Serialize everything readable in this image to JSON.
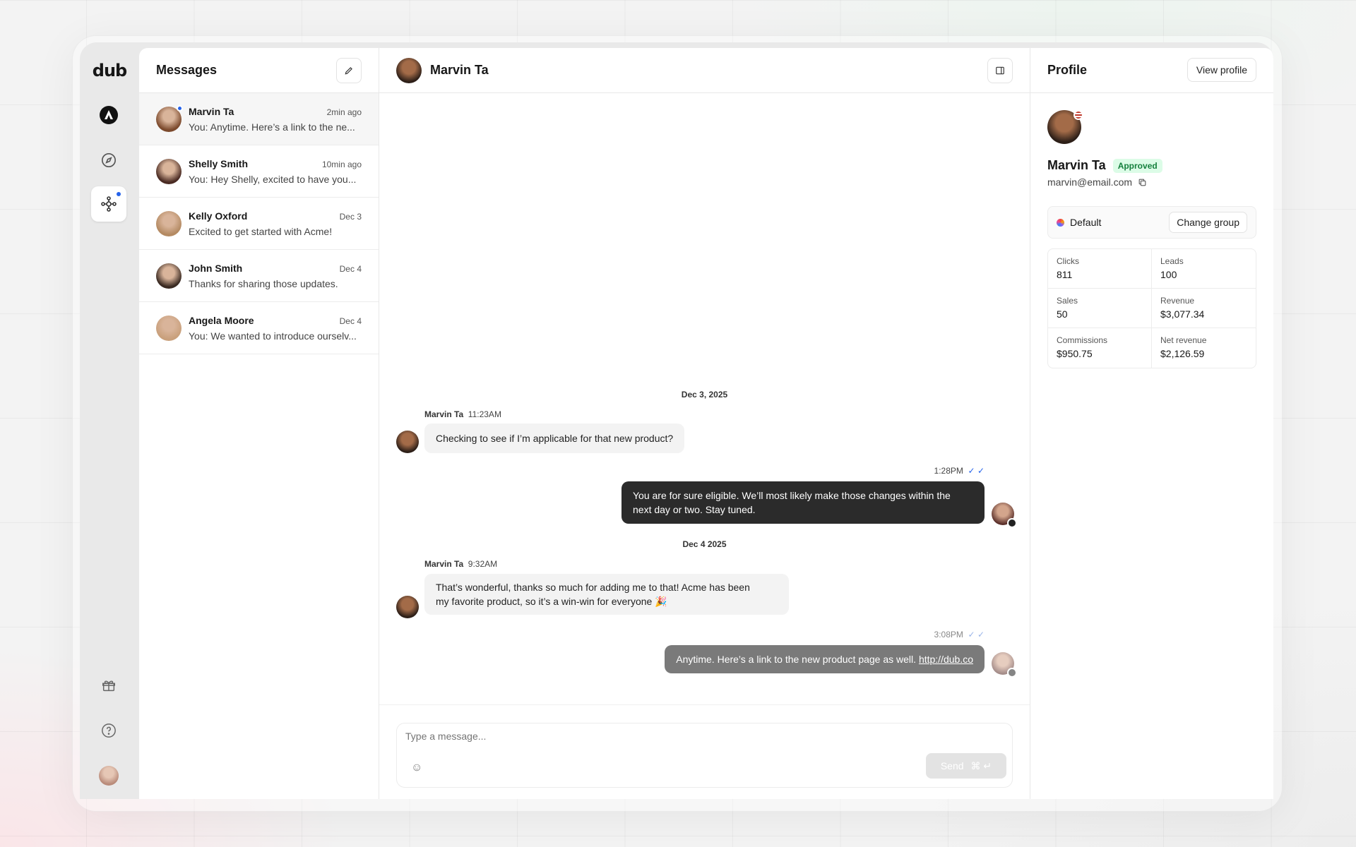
{
  "app": {
    "logo": "dub"
  },
  "messages_panel": {
    "title": "Messages",
    "conversations": [
      {
        "name": "Marvin Ta",
        "time": "2min ago",
        "preview": "You: Anytime. Here’s a link to the ne...",
        "avatar_color": "#7c4a2d",
        "online": true
      },
      {
        "name": "Shelly Smith",
        "time": "10min ago",
        "preview": "You: Hey Shelly, excited to have you...",
        "avatar_color": "#4a2b23",
        "online": false
      },
      {
        "name": "Kelly Oxford",
        "time": "Dec 3",
        "preview": "Excited to get started with Acme!",
        "avatar_color": "#b48a62",
        "online": false
      },
      {
        "name": "John Smith",
        "time": "Dec 4",
        "preview": "Thanks for sharing those updates.",
        "avatar_color": "#3a2a22",
        "online": false
      },
      {
        "name": "Angela Moore",
        "time": "Dec 4",
        "preview": "You: We wanted to introduce ourselv...",
        "avatar_color": "#c9a07c",
        "online": false
      }
    ]
  },
  "chat": {
    "contact_name": "Marvin Ta",
    "day1": "Dec 3, 2025",
    "day2": "Dec 4 2025",
    "msg1": {
      "sender": "Marvin Ta",
      "time": "11:23AM",
      "text": "Checking to see if I’m applicable for that new product?"
    },
    "msg2": {
      "time": "1:28PM",
      "line1": "You are for sure eligible. We’ll most likely make those changes within the",
      "line2": "next day or two. Stay tuned."
    },
    "msg3": {
      "sender": "Marvin Ta",
      "time": "9:32AM",
      "line1": "That’s wonderful, thanks so much for adding me to that! Acme has been",
      "line2": "my favorite product, so it’s a win-win for everyone 🎉"
    },
    "msg4": {
      "time": "3:08PM",
      "text": "Anytime. Here’s a link to the new product page as well.",
      "link": "http://dub.co"
    },
    "composer": {
      "placeholder": "Type a message...",
      "send_label": "Send",
      "shortcut": "⌘ ↵"
    }
  },
  "profile": {
    "title": "Profile",
    "view_button": "View profile",
    "name": "Marvin Ta",
    "status": "Approved",
    "email": "marvin@email.com",
    "group": "Default",
    "change_group": "Change group",
    "stats": [
      {
        "label": "Clicks",
        "value": "811"
      },
      {
        "label": "Leads",
        "value": "100"
      },
      {
        "label": "Sales",
        "value": "50"
      },
      {
        "label": "Revenue",
        "value": "$3,077.34"
      },
      {
        "label": "Commissions",
        "value": "$950.75"
      },
      {
        "label": "Net revenue",
        "value": "$2,126.59"
      }
    ]
  },
  "colors": {
    "accent": "#2563eb",
    "approved_bg": "#dcfce7",
    "approved_text": "#15803d",
    "dark_bubble": "#2b2b2b"
  }
}
